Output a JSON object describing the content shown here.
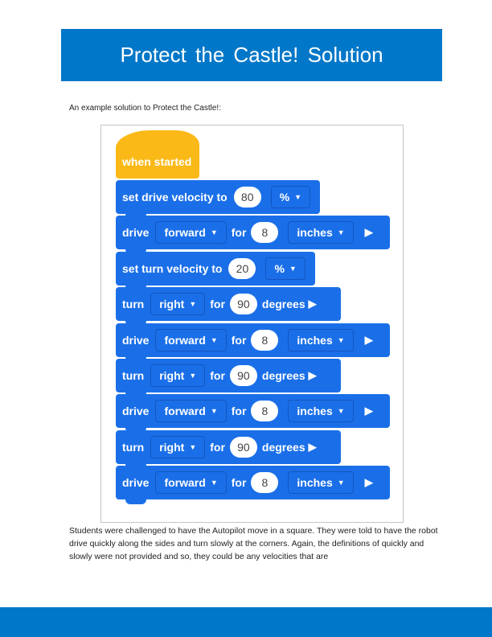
{
  "header": {
    "title": "Protect the Castle! Solution"
  },
  "intro": "An example solution to Protect the Castle!:",
  "program": {
    "hat": "when started",
    "blocks": [
      {
        "kind": "set",
        "label": "set drive velocity to",
        "value": "80",
        "unit": "%"
      },
      {
        "kind": "drive",
        "label": "drive",
        "dir": "forward",
        "for": "for",
        "value": "8",
        "unit": "inches"
      },
      {
        "kind": "set",
        "label": "set turn velocity to",
        "value": "20",
        "unit": "%"
      },
      {
        "kind": "turn",
        "label": "turn",
        "dir": "right",
        "for": "for",
        "value": "90",
        "unit": "degrees"
      },
      {
        "kind": "drive",
        "label": "drive",
        "dir": "forward",
        "for": "for",
        "value": "8",
        "unit": "inches"
      },
      {
        "kind": "turn",
        "label": "turn",
        "dir": "right",
        "for": "for",
        "value": "90",
        "unit": "degrees"
      },
      {
        "kind": "drive",
        "label": "drive",
        "dir": "forward",
        "for": "for",
        "value": "8",
        "unit": "inches"
      },
      {
        "kind": "turn",
        "label": "turn",
        "dir": "right",
        "for": "for",
        "value": "90",
        "unit": "degrees"
      },
      {
        "kind": "drive",
        "label": "drive",
        "dir": "forward",
        "for": "for",
        "value": "8",
        "unit": "inches"
      }
    ]
  },
  "body": "Students were challenged to have the Autopilot move in a square. They were told to have the robot drive quickly along the sides and turn slowly at the corners. Again, the definitions of quickly and slowly were not provided and so, they could be any velocities that are",
  "colors": {
    "brand": "#0077c8",
    "event_block": "#fbb917",
    "motion_block": "#1a6fe8"
  }
}
